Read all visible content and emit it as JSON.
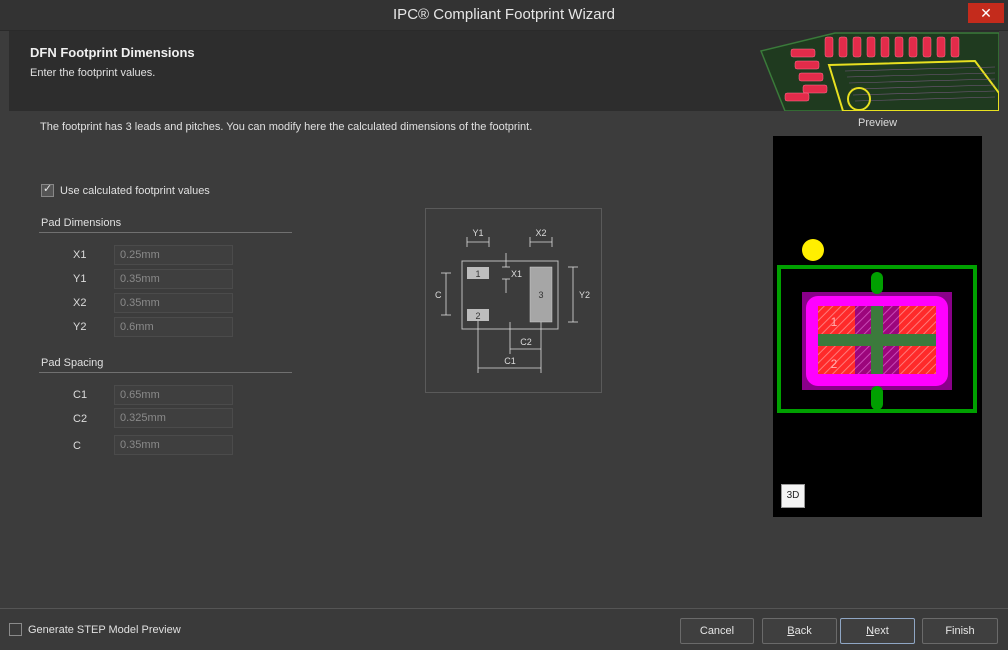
{
  "window": {
    "title": "IPC® Compliant Footprint Wizard",
    "close_label": "✕"
  },
  "header": {
    "title": "DFN Footprint Dimensions",
    "subtitle": "Enter the footprint values."
  },
  "intro_text": "The footprint has 3 leads and pitches. You can modify here the calculated dimensions of the footprint.",
  "use_calculated": {
    "label": "Use calculated footprint values",
    "checked": true
  },
  "pad_dimensions": {
    "title": "Pad Dimensions",
    "fields": [
      {
        "label": "X1",
        "value": "0.25mm"
      },
      {
        "label": "Y1",
        "value": "0.35mm"
      },
      {
        "label": "X2",
        "value": "0.35mm"
      },
      {
        "label": "Y2",
        "value": "0.6mm"
      }
    ]
  },
  "pad_spacing": {
    "title": "Pad Spacing",
    "fields": [
      {
        "label": "C1",
        "value": "0.65mm"
      },
      {
        "label": "C2",
        "value": "0.325mm"
      },
      {
        "label": "C",
        "value": "0.35mm"
      }
    ]
  },
  "diagram": {
    "labels": {
      "y1": "Y1",
      "x2": "X2",
      "x1": "X1",
      "c": "C",
      "y2": "Y2",
      "c2": "C2",
      "c1": "C1"
    },
    "pads": {
      "p1": "1",
      "p2": "2",
      "p3": "3"
    }
  },
  "preview": {
    "label": "Preview",
    "pad1": "1",
    "pad2": "2",
    "btn_3d": "3D",
    "colors": {
      "silkscreen": "#008000",
      "courtyard": "#ff00ff",
      "pad": "#ff2020",
      "pin1_marker": "#ffff00"
    }
  },
  "footer": {
    "step_preview": {
      "label": "Generate STEP Model Preview",
      "checked": false
    },
    "buttons": {
      "cancel": "Cancel",
      "back_pre": "",
      "back_u": "B",
      "back_post": "ack",
      "next_pre": "",
      "next_u": "N",
      "next_post": "ext",
      "finish": "Finish"
    }
  }
}
